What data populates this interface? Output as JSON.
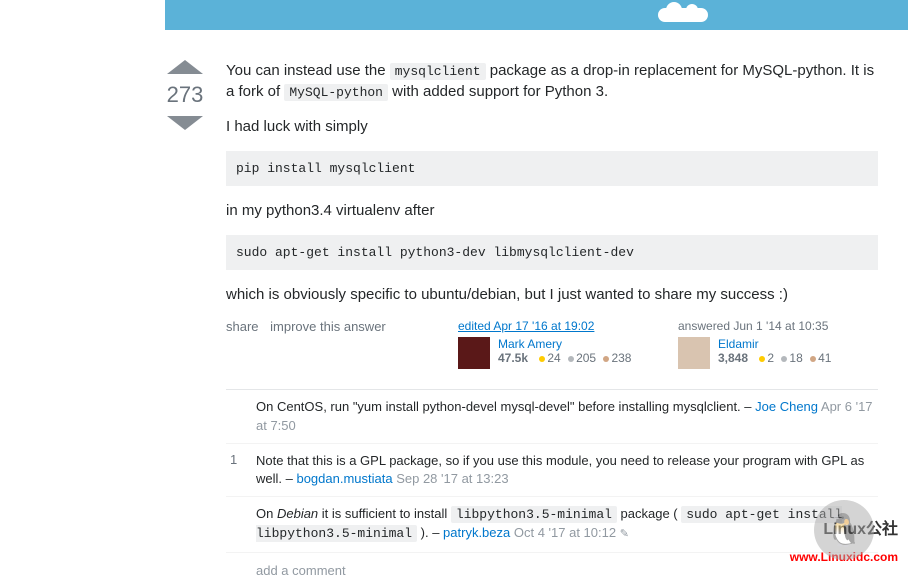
{
  "vote": {
    "count": "273"
  },
  "post": {
    "p1a": "You can instead use the ",
    "code1": "mysqlclient",
    "p1b": " package as a drop-in replacement for MySQL-python. It is a fork of ",
    "code2": "MySQL-python",
    "p1c": " with added support for Python 3.",
    "p2": "I had luck with simply",
    "codeblock1": "pip install mysqlclient",
    "p3": "in my python3.4 virtualenv after",
    "codeblock2": "sudo apt-get install python3-dev libmysqlclient-dev",
    "p4": "which is obviously specific to ubuntu/debian, but I just wanted to share my success :)"
  },
  "actions": {
    "share": "share",
    "improve": "improve this answer"
  },
  "editor": {
    "line": "edited Apr 17 '16 at 19:02",
    "name": "Mark Amery",
    "rep": "47.5k",
    "gold": "24",
    "silver": "205",
    "bronze": "238"
  },
  "author": {
    "line": "answered Jun 1 '14 at 10:35",
    "name": "Eldamir",
    "rep": "3,848",
    "gold": "2",
    "silver": "18",
    "bronze": "41"
  },
  "comments": [
    {
      "vote": "",
      "text": "On CentOS, run \"yum install python-devel mysql-devel\" before installing mysqlclient. – ",
      "user": "Joe Cheng",
      "date": " Apr 6 '17 at 7:50"
    },
    {
      "vote": "1",
      "text": "Note that this is a GPL package, so if you use this module, you need to release your program with GPL as well. – ",
      "user": "bogdan.mustiata",
      "date": " Sep 28 '17 at 13:23"
    },
    {
      "vote": "",
      "prefix": "On ",
      "em": "Debian",
      "mid": " it is sufficient to install ",
      "code1": "libpython3.5-minimal",
      "mid2": " package ( ",
      "code2": "sudo apt-get install libpython3.5-minimal",
      "mid3": " ). – ",
      "user": "patryk.beza",
      "date": " Oct 4 '17 at 10:12"
    }
  ],
  "addComment": "add a comment",
  "watermark": {
    "cn": "Linux公社",
    "url": "www.Linuxidc.com"
  }
}
